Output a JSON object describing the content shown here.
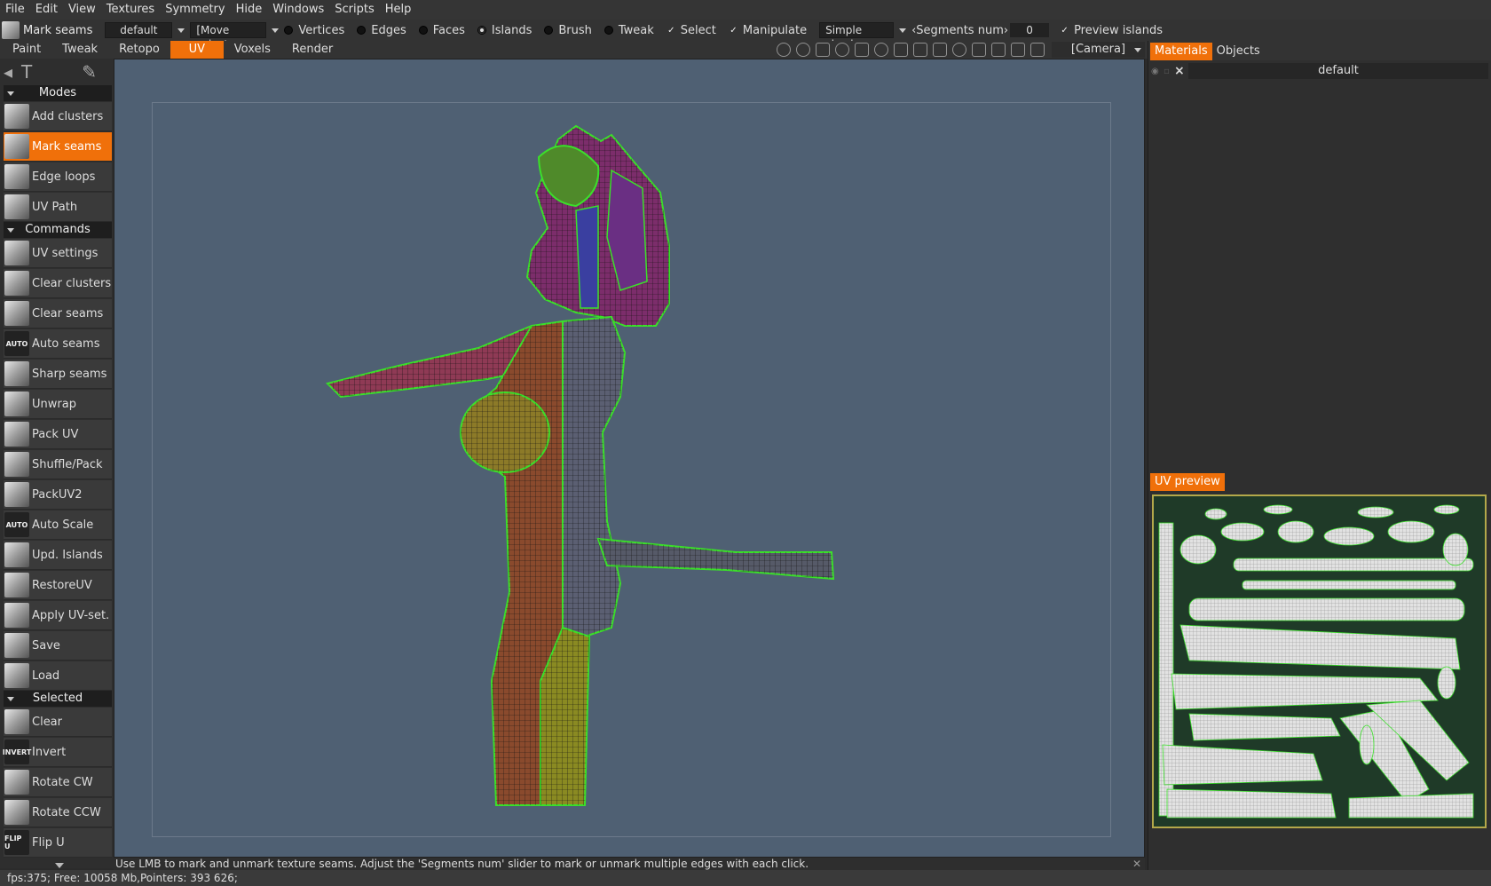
{
  "menu": [
    "File",
    "Edit",
    "View",
    "Textures",
    "Symmetry",
    "Hide",
    "Windows",
    "Scripts",
    "Help"
  ],
  "options": {
    "tool_name": "Mark seams",
    "preset": "default",
    "move_select": "[Move select",
    "radios": [
      {
        "label": "Vertices",
        "on": false
      },
      {
        "label": "Edges",
        "on": false
      },
      {
        "label": "Faces",
        "on": false
      },
      {
        "label": "Islands",
        "on": true
      },
      {
        "label": "Brush",
        "on": false
      },
      {
        "label": "Tweak",
        "on": false
      }
    ],
    "checks": [
      {
        "label": "Select",
        "checked": true
      },
      {
        "label": "Manipulate",
        "checked": true
      }
    ],
    "simple_check": "Simple check",
    "segments_label": "‹Segments num›",
    "segments_value": "0",
    "preview_islands": "Preview islands"
  },
  "rooms": [
    "Paint",
    "Tweak",
    "Retopo",
    "UV",
    "Voxels",
    "Render"
  ],
  "active_room": "UV",
  "camera": "[Camera]",
  "left": {
    "sections": {
      "modes": "Modes",
      "commands": "Commands",
      "selected": "Selected"
    },
    "modes": [
      {
        "label": "Add clusters",
        "icon": "cube-icon"
      },
      {
        "label": "Mark seams",
        "icon": "cube-icon",
        "active": true
      },
      {
        "label": "Edge loops",
        "icon": "cube-icon"
      },
      {
        "label": "UV Path",
        "icon": "cube-icon"
      }
    ],
    "commands": [
      {
        "label": "UV settings",
        "icon": "sliders-icon"
      },
      {
        "label": "Clear clusters",
        "icon": "x-icon"
      },
      {
        "label": "Clear seams",
        "icon": "x-icon"
      },
      {
        "label": "Auto seams",
        "icon": "auto-icon",
        "glyph": "AUTO"
      },
      {
        "label": "Sharp seams",
        "icon": "cube-icon"
      },
      {
        "label": "Unwrap",
        "icon": "grid-icon"
      },
      {
        "label": "Pack UV",
        "icon": "pack-icon"
      },
      {
        "label": "Shuffle/Pack",
        "icon": "move-icon"
      },
      {
        "label": "PackUV2",
        "icon": "pack-icon"
      },
      {
        "label": "Auto Scale",
        "icon": "auto-icon",
        "glyph": "AUTO"
      },
      {
        "label": "Upd. Islands",
        "icon": "refresh-icon"
      },
      {
        "label": "RestoreUV",
        "icon": "restore-icon"
      },
      {
        "label": "Apply UV-set.",
        "icon": "check-icon"
      },
      {
        "label": "Save",
        "icon": "save-icon"
      },
      {
        "label": "Load",
        "icon": "load-icon"
      }
    ],
    "selected": [
      {
        "label": "Clear",
        "icon": "x-icon"
      },
      {
        "label": "Invert",
        "icon": "invert-icon",
        "glyph": "INVERT"
      },
      {
        "label": "Rotate CW",
        "icon": "rotate-cw-icon"
      },
      {
        "label": "Rotate CCW",
        "icon": "rotate-ccw-icon"
      },
      {
        "label": "Flip U",
        "icon": "flip-icon",
        "glyph": "FLIP U"
      }
    ]
  },
  "hint": "Use LMB to mark and unmark texture seams. Adjust the 'Segments num' slider to mark or unmark multiple edges with each click.",
  "status": "fps:375;   Free: 10058 Mb,Pointers: 393 626;",
  "right": {
    "tabs": [
      "Materials",
      "Objects"
    ],
    "material": "default",
    "uv_preview": "UV preview"
  },
  "colors": {
    "accent": "#f0700a",
    "viewport_bg": "#4f6073",
    "seam": "#3be02a"
  }
}
